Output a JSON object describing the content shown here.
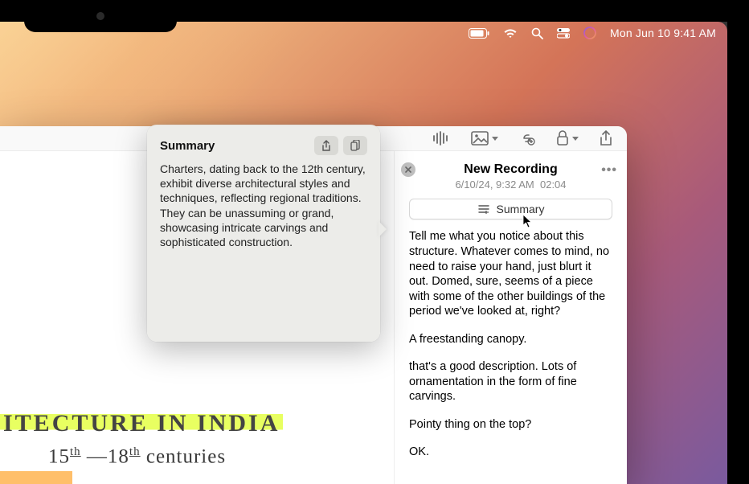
{
  "menubar": {
    "datetime": "Mon Jun 10  9:41 AM"
  },
  "popover": {
    "title": "Summary",
    "body": "Charters, dating back to the 12th century, exhibit diverse architectural styles and techniques, reflecting regional traditions. They can be unassuming or grand, showcasing intricate carvings and sophisticated construction."
  },
  "recording": {
    "title": "New Recording",
    "date": "6/10/24, 9:32 AM",
    "duration": "02:04",
    "summary_button": "Summary",
    "transcript": {
      "p1": "Tell me what you notice about this structure. Whatever comes to mind, no need to raise your hand, just blurt it out. Domed, sure, seems of a piece with some of the other buildings of the period we've looked at, right?",
      "p2": "A freestanding canopy.",
      "p3": "that's a good description. Lots of ornamentation in the form of fine carvings.",
      "p4": "Pointy thing on the top?",
      "p5": "OK."
    }
  },
  "handwriting": {
    "line1": "ITECTURE IN INDIA",
    "line2_prefix": "15",
    "line2_sup1": "th",
    "line2_dash": " —18",
    "line2_sup2": "th",
    "line2_suffix": " centuries"
  }
}
